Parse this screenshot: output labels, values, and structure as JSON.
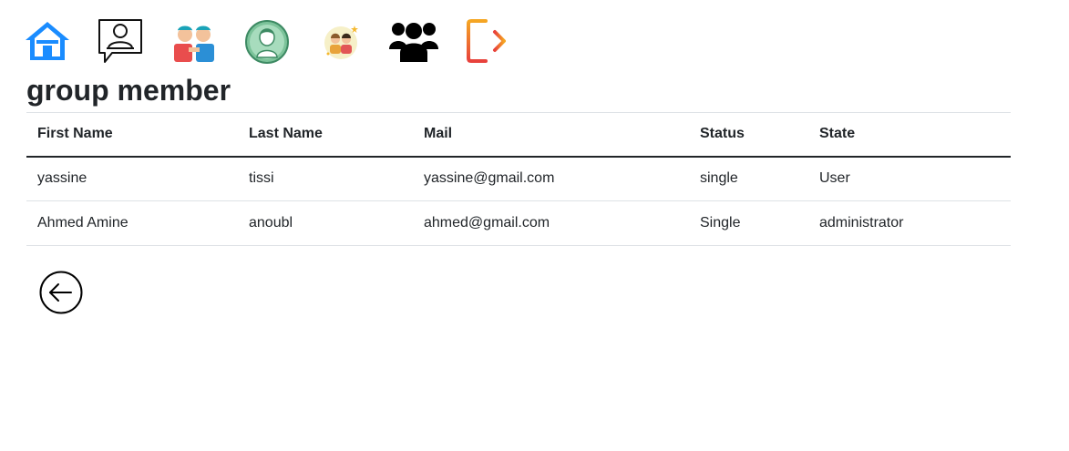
{
  "nav": {
    "items": [
      {
        "name": "home",
        "icon": "home-icon"
      },
      {
        "name": "profile",
        "icon": "user-chat-icon"
      },
      {
        "name": "friends",
        "icon": "friends-icon"
      },
      {
        "name": "avatar",
        "icon": "avatar-icon"
      },
      {
        "name": "couple",
        "icon": "couple-icon"
      },
      {
        "name": "groups",
        "icon": "group-icon"
      },
      {
        "name": "logout",
        "icon": "logout-icon"
      }
    ]
  },
  "page": {
    "title": "group member"
  },
  "table": {
    "headers": [
      "First Name",
      "Last Name",
      "Mail",
      "Status",
      "State"
    ],
    "rows": [
      [
        "yassine",
        "tissi",
        "yassine@gmail.com",
        "single",
        "User"
      ],
      [
        "Ahmed Amine",
        "anoubl",
        "ahmed@gmail.com",
        "Single",
        "administrator"
      ]
    ]
  },
  "back": {
    "icon": "arrow-left-circle-icon"
  },
  "colors": {
    "home": "#1a8cff",
    "logout_start": "#f5a623",
    "logout_end": "#e8413c",
    "text": "#212529",
    "border": "#dee2e6"
  }
}
